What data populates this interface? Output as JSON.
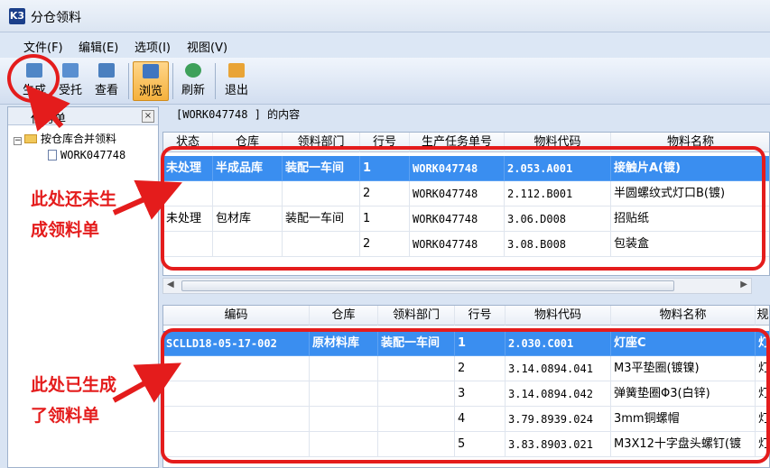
{
  "window": {
    "title": "分仓领料",
    "app_icon_text": "K3"
  },
  "menu": [
    "文件(F)",
    "编辑(E)",
    "选项(I)",
    "视图(V)"
  ],
  "toolbar": {
    "generate": "生成",
    "entrust": "受托",
    "view": "查看",
    "browse": "浏览",
    "refresh": "刷新",
    "exit": "退出"
  },
  "left_panel": {
    "title": "任务单",
    "close": "×",
    "tree_root": "按仓库合并领料",
    "tree_child": "WORK047748"
  },
  "content_caption": "[WORK047748 ]  的内容",
  "top_grid": {
    "headers": [
      "状态",
      "仓库",
      "领料部门",
      "行号",
      "生产任务单号",
      "物料代码",
      "物料名称"
    ],
    "rows": [
      [
        "未处理",
        "半成品库",
        "装配一车间",
        "1",
        "WORK047748",
        "2.053.A001",
        "接触片A(镀)"
      ],
      [
        "",
        "",
        "",
        "2",
        "WORK047748",
        "2.112.B001",
        "半圆螺纹式灯口B(镀)"
      ],
      [
        "未处理",
        "包材库",
        "装配一车间",
        "1",
        "WORK047748",
        "3.06.D008",
        "招贴纸"
      ],
      [
        "",
        "",
        "",
        "2",
        "WORK047748",
        "3.08.B008",
        "包装盒"
      ]
    ]
  },
  "bottom_grid": {
    "headers": [
      "编码",
      "仓库",
      "领料部门",
      "行号",
      "物料代码",
      "物料名称",
      "规"
    ],
    "rows": [
      [
        "SCLLD18-05-17-002",
        "原材料库",
        "装配一车间",
        "1",
        "2.030.C001",
        "灯座C",
        "灯"
      ],
      [
        "",
        "",
        "",
        "2",
        "3.14.0894.041",
        "M3平垫圈(镀镍)",
        "灯"
      ],
      [
        "",
        "",
        "",
        "3",
        "3.14.0894.042",
        "弹簧垫圈Φ3(白锌)",
        "灯"
      ],
      [
        "",
        "",
        "",
        "4",
        "3.79.8939.024",
        "3mm铜螺帽",
        "灯"
      ],
      [
        "",
        "",
        "",
        "5",
        "3.83.8903.021",
        "M3X12十字盘头螺钉(镀",
        "灯"
      ]
    ]
  },
  "annotations": {
    "not_generated": [
      "此处还未生",
      "成领料单"
    ],
    "generated": [
      "此处已生成",
      "了领料单"
    ]
  },
  "colors": {
    "selection": "#3a8ef0",
    "annotation": "#e41c1c",
    "browse_active": "#f5b13d"
  }
}
